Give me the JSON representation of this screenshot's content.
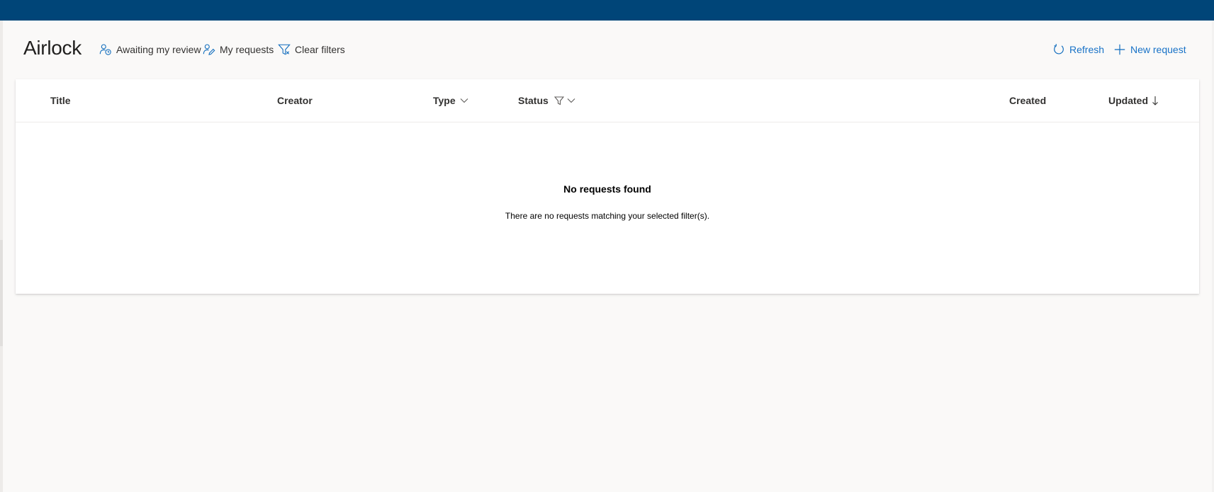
{
  "page": {
    "title": "Airlock"
  },
  "toolbar": {
    "awaiting_review": {
      "label": "Awaiting my review",
      "icon": "person-clock-icon"
    },
    "my_requests": {
      "label": "My requests",
      "icon": "person-edit-icon"
    },
    "clear_filters": {
      "label": "Clear filters",
      "icon": "filter-dismiss-icon"
    },
    "refresh": {
      "label": "Refresh",
      "icon": "refresh-icon"
    },
    "new_request": {
      "label": "New request",
      "icon": "add-icon"
    }
  },
  "table": {
    "columns": [
      {
        "key": "title",
        "label": "Title"
      },
      {
        "key": "creator",
        "label": "Creator"
      },
      {
        "key": "type",
        "label": "Type",
        "has_dropdown": true
      },
      {
        "key": "status",
        "label": "Status",
        "filtered": true,
        "has_dropdown": true
      },
      {
        "key": "created",
        "label": "Created"
      },
      {
        "key": "updated",
        "label": "Updated",
        "sort": "descending"
      }
    ],
    "rows": [],
    "empty": {
      "title": "No requests found",
      "message": "There are no requests matching your selected filter(s)."
    }
  },
  "colors": {
    "topbar": "#004578",
    "background": "#faf9f8",
    "accent": "#0f6cbd",
    "text": "#323130"
  }
}
